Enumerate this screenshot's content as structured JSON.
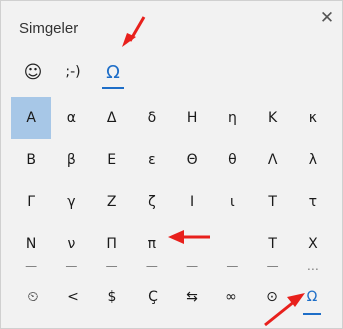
{
  "panel": {
    "title": "Simgeler"
  },
  "close_icon": "close-icon",
  "tabs": [
    {
      "name": "emoji",
      "label": "☺"
    },
    {
      "name": "kaomoji",
      "label": ";-)"
    },
    {
      "name": "symbols",
      "label": "Ω",
      "active": true
    }
  ],
  "grid": {
    "rows": [
      [
        "Α",
        "α",
        "Δ",
        "δ",
        "Η",
        "η",
        "Κ",
        "κ"
      ],
      [
        "Β",
        "β",
        "Ε",
        "ε",
        "Θ",
        "θ",
        "Λ",
        "λ"
      ],
      [
        "Γ",
        "γ",
        "Ζ",
        "ζ",
        "Ι",
        "ι",
        "Τ",
        "τ"
      ],
      [
        "Ν",
        "ν",
        "Π",
        "π",
        "",
        "",
        "Τ",
        "Χ"
      ]
    ],
    "partial_row_marks": [
      "—",
      "—",
      "—",
      "—",
      "—",
      "—",
      "—",
      "…"
    ],
    "selected": "Α"
  },
  "categories": [
    {
      "name": "recent",
      "label": "⏲"
    },
    {
      "name": "punctuation",
      "label": "<"
    },
    {
      "name": "currency",
      "label": "$"
    },
    {
      "name": "latin",
      "label": "Ç"
    },
    {
      "name": "arrows",
      "label": "⇆"
    },
    {
      "name": "math",
      "label": "∞"
    },
    {
      "name": "geometric",
      "label": "⊙"
    },
    {
      "name": "language",
      "label": "Ω",
      "active": true
    }
  ],
  "colors": {
    "accent": "#1e6ec8",
    "selected_bg": "#a7c7e7",
    "arrow": "#e8201c"
  }
}
